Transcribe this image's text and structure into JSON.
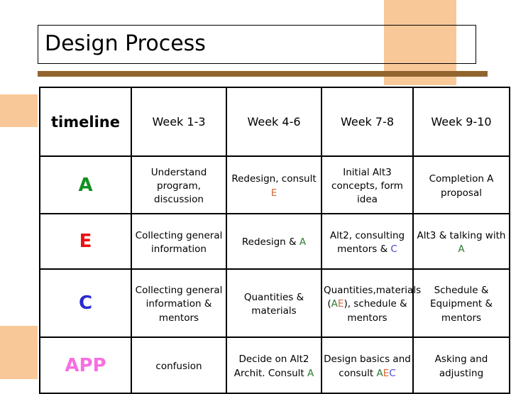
{
  "slide": {
    "title": "Design Process",
    "accent_orange": "#f9c898",
    "accent_brown": "#92642e",
    "accent_dark_brown": "#7d6344"
  },
  "table": {
    "header": {
      "label": "timeline",
      "weeks": [
        "Week 1-3",
        "Week 4-6",
        "Week 7-8",
        "Week 9-10"
      ]
    },
    "rows": [
      {
        "role": "A",
        "role_color": "#119122",
        "cells": [
          {
            "parts": [
              {
                "text": "Understand program, discussion",
                "color": ""
              }
            ]
          },
          {
            "parts": [
              {
                "text": "Redesign, consult ",
                "color": ""
              },
              {
                "text": "E",
                "color": "#d4673a"
              }
            ]
          },
          {
            "parts": [
              {
                "text": "Initial Alt3 concepts, form idea",
                "color": ""
              }
            ]
          },
          {
            "parts": [
              {
                "text": "Completion A proposal",
                "color": ""
              }
            ]
          }
        ]
      },
      {
        "role": "E",
        "role_color": "#ee1111",
        "cells": [
          {
            "parts": [
              {
                "text": "Collecting general information",
                "color": ""
              }
            ]
          },
          {
            "parts": [
              {
                "text": "Redesign & ",
                "color": ""
              },
              {
                "text": "A",
                "color": "#2d7a33"
              }
            ]
          },
          {
            "parts": [
              {
                "text": "Alt2, consulting mentors & ",
                "color": ""
              },
              {
                "text": "C",
                "color": "#4646c8"
              }
            ]
          },
          {
            "parts": [
              {
                "text": "Alt3 & talking with ",
                "color": ""
              },
              {
                "text": "A",
                "color": "#2d7a33"
              }
            ]
          }
        ]
      },
      {
        "role": "C",
        "role_color": "#2a2ad4",
        "cells": [
          {
            "parts": [
              {
                "text": "Collecting general information & mentors",
                "color": ""
              }
            ]
          },
          {
            "parts": [
              {
                "text": "Quantities & materials",
                "color": ""
              }
            ]
          },
          {
            "parts": [
              {
                "text": "Quantities,materials (",
                "color": ""
              },
              {
                "text": "A",
                "color": "#2d7a33"
              },
              {
                "text": "E",
                "color": "#d4673a"
              },
              {
                "text": "), schedule & mentors",
                "color": ""
              }
            ]
          },
          {
            "parts": [
              {
                "text": "Schedule & Equipment & mentors",
                "color": ""
              }
            ]
          }
        ]
      },
      {
        "role": "APP",
        "role_color": "#f76fe0",
        "cells": [
          {
            "parts": [
              {
                "text": "confusion",
                "color": ""
              }
            ]
          },
          {
            "parts": [
              {
                "text": "Decide on Alt2 Archit. Consult ",
                "color": ""
              },
              {
                "text": "A",
                "color": "#2d7a33"
              }
            ]
          },
          {
            "parts": [
              {
                "text": "Design basics and consult ",
                "color": ""
              },
              {
                "text": "A",
                "color": "#2d7a33"
              },
              {
                "text": "E",
                "color": "#d4673a"
              },
              {
                "text": "C",
                "color": "#4646c8"
              }
            ]
          },
          {
            "parts": [
              {
                "text": "Asking and adjusting",
                "color": ""
              }
            ]
          }
        ]
      }
    ]
  }
}
